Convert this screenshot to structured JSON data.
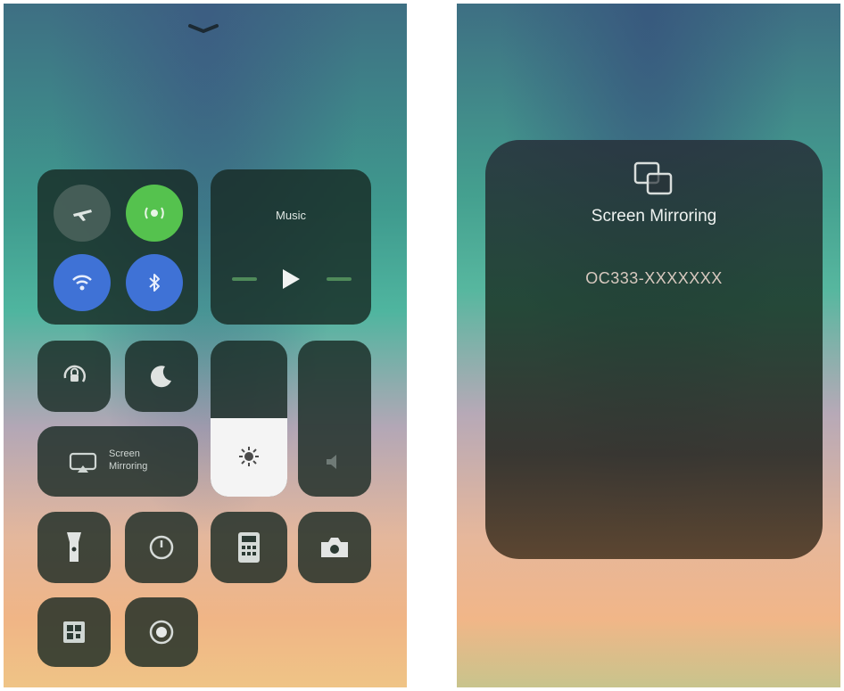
{
  "control_center": {
    "now_playing": {
      "title": "Music"
    },
    "screen_mirroring_tile": {
      "line1": "Screen",
      "line2": "Mirroring"
    },
    "tiles": {
      "airplane": "airplane-icon",
      "cellular": "cellular-data-icon",
      "wifi": "wifi-icon",
      "bluetooth": "bluetooth-icon",
      "orientation_lock": "orientation-lock-icon",
      "do_not_disturb": "moon-icon",
      "flashlight": "flashlight-icon",
      "timer": "timer-icon",
      "calculator": "calculator-icon",
      "camera": "camera-icon",
      "qr": "qr-code-icon",
      "record": "screen-record-icon"
    }
  },
  "screen_mirroring_popup": {
    "title": "Screen Mirroring",
    "device": "OC333-XXXXXXX"
  },
  "colors": {
    "cellular_on": "#55c24e",
    "wifi_on": "#3f72d6",
    "bluetooth_on": "#3f72d6"
  }
}
